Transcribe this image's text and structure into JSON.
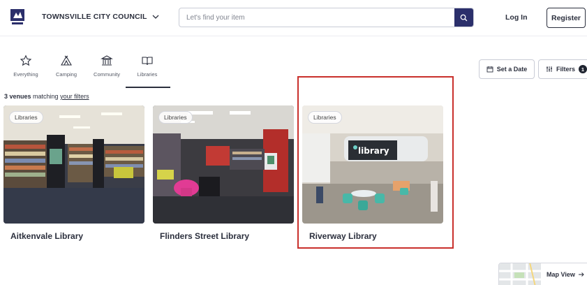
{
  "header": {
    "council_name": "TOWNSVILLE CITY COUNCIL",
    "search_placeholder": "Let's find your item",
    "login_label": "Log In",
    "register_label": "Register"
  },
  "categories": [
    {
      "label": "Everything",
      "icon": "star-icon"
    },
    {
      "label": "Camping",
      "icon": "tent-icon"
    },
    {
      "label": "Community",
      "icon": "building-icon"
    },
    {
      "label": "Libraries",
      "icon": "book-icon",
      "active": true
    }
  ],
  "toolbar": {
    "date_label": "Set a Date",
    "filters_label": "Filters",
    "filters_count": "1"
  },
  "results": {
    "count_text": "3 venues",
    "matching_text": " matching ",
    "filters_link": "your filters"
  },
  "venues": [
    {
      "tag": "Libraries",
      "name": "Aitkenvale Library"
    },
    {
      "tag": "Libraries",
      "name": "Flinders Street Library"
    },
    {
      "tag": "Libraries",
      "name": "Riverway Library",
      "highlighted": true
    }
  ],
  "map_view": {
    "label": "Map View"
  },
  "colors": {
    "primary": "#2b2f6b",
    "highlight": "#c9302c"
  }
}
